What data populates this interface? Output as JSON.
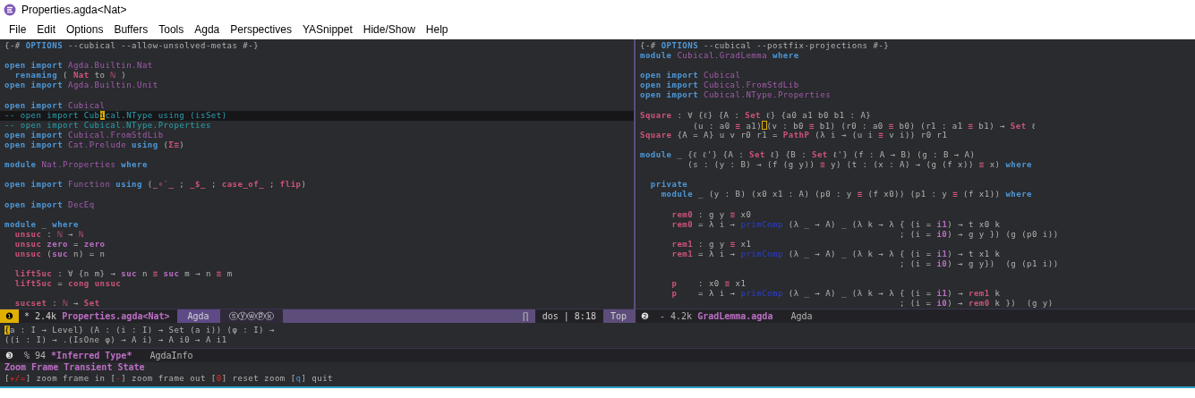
{
  "window": {
    "title": "Properties.agda<Nat>"
  },
  "menu": [
    "File",
    "Edit",
    "Options",
    "Buffers",
    "Tools",
    "Agda",
    "Perspectives",
    "YASnippet",
    "Hide/Show",
    "Help"
  ],
  "panes": [
    {
      "lines": [
        {
          "current": false,
          "segs": [
            {
              "text": "{-# ",
              "kind": "plain"
            },
            {
              "text": "OPTIONS",
              "kind": "keyword"
            },
            {
              "text": " --cubical --allow-unsolved-metas #-}",
              "kind": "plain"
            }
          ]
        },
        {
          "current": false
        },
        {
          "current": false,
          "segs": [
            {
              "text": "open import ",
              "kind": "keyword"
            },
            {
              "text": "Agda.Builtin.Nat",
              "kind": "module"
            }
          ]
        },
        {
          "current": false,
          "segs": [
            {
              "text": "  renaming",
              "kind": "keyword"
            },
            {
              "text": " ( ",
              "kind": "plain"
            },
            {
              "text": "Nat",
              "kind": "function"
            },
            {
              "text": " to ",
              "kind": "plain"
            },
            {
              "text": "ℕ",
              "kind": "function"
            },
            {
              "text": " )",
              "kind": "plain"
            }
          ]
        },
        {
          "current": false,
          "segs": [
            {
              "text": "open import ",
              "kind": "keyword"
            },
            {
              "text": "Agda.Builtin.Unit",
              "kind": "module"
            }
          ]
        },
        {
          "current": false
        },
        {
          "current": false,
          "segs": [
            {
              "text": "open import ",
              "kind": "keyword"
            },
            {
              "text": "Cubical",
              "kind": "module"
            }
          ]
        },
        {
          "current": true,
          "segs": [
            {
              "text": "-- open import Cub",
              "kind": "comment"
            },
            {
              "text": "i",
              "kind": "cursor"
            },
            {
              "text": "cal.NType using (isSet)",
              "kind": "comment"
            }
          ]
        },
        {
          "current": false,
          "segs": [
            {
              "text": "-- open import Cubical.NType.Properties",
              "kind": "comment"
            }
          ]
        },
        {
          "current": false,
          "segs": [
            {
              "text": "open import ",
              "kind": "keyword"
            },
            {
              "text": "Cubical.FromStdLib",
              "kind": "module"
            }
          ]
        },
        {
          "current": false,
          "segs": [
            {
              "text": "open import ",
              "kind": "keyword"
            },
            {
              "text": "Cat.Prelude ",
              "kind": "module"
            },
            {
              "text": "using",
              "kind": "keyword"
            },
            {
              "text": " (",
              "kind": "plain"
            },
            {
              "text": "Σ≡",
              "kind": "function"
            },
            {
              "text": ")",
              "kind": "plain"
            }
          ]
        },
        {
          "current": false
        },
        {
          "current": false,
          "segs": [
            {
              "text": "module ",
              "kind": "keyword"
            },
            {
              "text": "Nat.Properties ",
              "kind": "module"
            },
            {
              "text": "where",
              "kind": "keyword"
            }
          ]
        },
        {
          "current": false
        },
        {
          "current": false,
          "segs": [
            {
              "text": "open import ",
              "kind": "keyword"
            },
            {
              "text": "Function ",
              "kind": "module"
            },
            {
              "text": "using",
              "kind": "keyword"
            },
            {
              "text": " (",
              "kind": "plain"
            },
            {
              "text": "_∘′_",
              "kind": "function"
            },
            {
              "text": " ; ",
              "kind": "plain"
            },
            {
              "text": "_$_",
              "kind": "function"
            },
            {
              "text": " ; ",
              "kind": "plain"
            },
            {
              "text": "case_of_",
              "kind": "function"
            },
            {
              "text": " ; ",
              "kind": "plain"
            },
            {
              "text": "flip",
              "kind": "function"
            },
            {
              "text": ")",
              "kind": "plain"
            }
          ]
        },
        {
          "current": false
        },
        {
          "current": false,
          "segs": [
            {
              "text": "open import ",
              "kind": "keyword"
            },
            {
              "text": "DecEq",
              "kind": "module"
            }
          ]
        },
        {
          "current": false
        },
        {
          "current": false,
          "segs": [
            {
              "text": "module",
              "kind": "keyword"
            },
            {
              "text": " _ ",
              "kind": "plain"
            },
            {
              "text": "where",
              "kind": "keyword"
            }
          ]
        },
        {
          "current": false,
          "segs": [
            {
              "text": "  unsuc",
              "kind": "function"
            },
            {
              "text": " : ",
              "kind": "plain"
            },
            {
              "text": "ℕ",
              "kind": "function"
            },
            {
              "text": " → ",
              "kind": "plain"
            },
            {
              "text": "ℕ",
              "kind": "function"
            }
          ]
        },
        {
          "current": false,
          "segs": [
            {
              "text": "  unsuc ",
              "kind": "function"
            },
            {
              "text": "zero",
              "kind": "constructor"
            },
            {
              "text": " = ",
              "kind": "plain"
            },
            {
              "text": "zero",
              "kind": "constructor"
            }
          ]
        },
        {
          "current": false,
          "segs": [
            {
              "text": "  unsuc",
              "kind": "function"
            },
            {
              "text": " (",
              "kind": "plain"
            },
            {
              "text": "suc",
              "kind": "constructor"
            },
            {
              "text": " n) = n",
              "kind": "plain"
            }
          ]
        },
        {
          "current": false
        },
        {
          "current": false,
          "segs": [
            {
              "text": "  liftSuc",
              "kind": "function"
            },
            {
              "text": " : ∀ {n m} → ",
              "kind": "plain"
            },
            {
              "text": "suc",
              "kind": "constructor"
            },
            {
              "text": " n ",
              "kind": "plain"
            },
            {
              "text": "≡ ",
              "kind": "function"
            },
            {
              "text": "suc",
              "kind": "constructor"
            },
            {
              "text": " m → n ",
              "kind": "plain"
            },
            {
              "text": "≡",
              "kind": "function"
            },
            {
              "text": " m",
              "kind": "plain"
            }
          ]
        },
        {
          "current": false,
          "segs": [
            {
              "text": "  liftSuc",
              "kind": "function"
            },
            {
              "text": " = ",
              "kind": "plain"
            },
            {
              "text": "cong unsuc",
              "kind": "function"
            }
          ]
        },
        {
          "current": false
        },
        {
          "current": false,
          "segs": [
            {
              "text": "  sucset",
              "kind": "function"
            },
            {
              "text": " : ",
              "kind": "plain"
            },
            {
              "text": "ℕ",
              "kind": "function"
            },
            {
              "text": " → ",
              "kind": "plain"
            },
            {
              "text": "Set",
              "kind": "function"
            }
          ]
        }
      ],
      "modeline": {
        "number": "❶",
        "active": true,
        "state": "* 2.4k",
        "buffer": "Properties.agda<Nat>",
        "mode": "Agda",
        "minor_modes": "ⓢⓨⓦⓟⓚ",
        "glyph": "∏",
        "line_info": "dos | 8:18",
        "position": "Top"
      }
    },
    {
      "lines": [
        {
          "current": false,
          "segs": [
            {
              "text": "{-# ",
              "kind": "plain"
            },
            {
              "text": "OPTIONS",
              "kind": "keyword"
            },
            {
              "text": " --cubical --postfix-projections #-}",
              "kind": "plain"
            }
          ]
        },
        {
          "current": false,
          "segs": [
            {
              "text": "module ",
              "kind": "keyword"
            },
            {
              "text": "Cubical.GradLemma ",
              "kind": "module"
            },
            {
              "text": "where",
              "kind": "keyword"
            }
          ]
        },
        {
          "current": false
        },
        {
          "current": false,
          "segs": [
            {
              "text": "open import ",
              "kind": "keyword"
            },
            {
              "text": "Cubical",
              "kind": "module"
            }
          ]
        },
        {
          "current": false,
          "segs": [
            {
              "text": "open import ",
              "kind": "keyword"
            },
            {
              "text": "Cubical.FromStdLib",
              "kind": "module"
            }
          ]
        },
        {
          "current": false,
          "segs": [
            {
              "text": "open import ",
              "kind": "keyword"
            },
            {
              "text": "Cubical.NType.Properties",
              "kind": "module"
            }
          ]
        },
        {
          "current": false
        },
        {
          "current": false,
          "segs": [
            {
              "text": "Square",
              "kind": "function"
            },
            {
              "text": " : ∀ {ℓ} {A : ",
              "kind": "plain"
            },
            {
              "text": "Set",
              "kind": "function"
            },
            {
              "text": " ℓ} {a0 a1 b0 b1 : A}",
              "kind": "plain"
            }
          ]
        },
        {
          "current": false,
          "segs": [
            {
              "text": "          (u : a0 ",
              "kind": "plain"
            },
            {
              "text": "≡",
              "kind": "function"
            },
            {
              "text": " a1)",
              "kind": "plain"
            },
            {
              "text": "(v : b0 ",
              "kind": "plain",
              "box_cursor_before": true
            },
            {
              "text": "≡",
              "kind": "function"
            },
            {
              "text": " b1) (r0 : a0 ",
              "kind": "plain"
            },
            {
              "text": "≡",
              "kind": "function"
            },
            {
              "text": " b0) (r1 : a1 ",
              "kind": "plain"
            },
            {
              "text": "≡",
              "kind": "function"
            },
            {
              "text": " b1) → ",
              "kind": "plain"
            },
            {
              "text": "Set",
              "kind": "function"
            },
            {
              "text": " ℓ",
              "kind": "plain"
            }
          ]
        },
        {
          "current": false,
          "segs": [
            {
              "text": "Square",
              "kind": "function"
            },
            {
              "text": " {A = A} u v r0 r1 = ",
              "kind": "plain"
            },
            {
              "text": "PathP",
              "kind": "function"
            },
            {
              "text": " (λ i → (u i ",
              "kind": "plain"
            },
            {
              "text": "≡",
              "kind": "function"
            },
            {
              "text": " v i)) r0 r1",
              "kind": "plain"
            }
          ]
        },
        {
          "current": false
        },
        {
          "current": false,
          "segs": [
            {
              "text": "module",
              "kind": "keyword"
            },
            {
              "text": " _ {ℓ ℓ'} {A : ",
              "kind": "plain"
            },
            {
              "text": "Set",
              "kind": "function"
            },
            {
              "text": " ℓ} {B : ",
              "kind": "plain"
            },
            {
              "text": "Set",
              "kind": "function"
            },
            {
              "text": " ℓ'} (f : A → B) (g : B → A)",
              "kind": "plain"
            }
          ]
        },
        {
          "current": false,
          "segs": [
            {
              "text": "         (s : (y : B) → (f (g y)) ",
              "kind": "plain"
            },
            {
              "text": "≡",
              "kind": "function"
            },
            {
              "text": " y) (t : (x : A) → (g (f x)) ",
              "kind": "plain"
            },
            {
              "text": "≡",
              "kind": "function"
            },
            {
              "text": " x) ",
              "kind": "plain"
            },
            {
              "text": "where",
              "kind": "keyword"
            }
          ]
        },
        {
          "current": false
        },
        {
          "current": false,
          "segs": [
            {
              "text": "  private",
              "kind": "keyword"
            }
          ]
        },
        {
          "current": false,
          "segs": [
            {
              "text": "    module",
              "kind": "keyword"
            },
            {
              "text": " _ (y : B) (x0 x1 : A) (p0 : y ",
              "kind": "plain"
            },
            {
              "text": "≡",
              "kind": "function"
            },
            {
              "text": " (f x0)) (p1 : y ",
              "kind": "plain"
            },
            {
              "text": "≡",
              "kind": "function"
            },
            {
              "text": " (f x1)) ",
              "kind": "plain"
            },
            {
              "text": "where",
              "kind": "keyword"
            }
          ]
        },
        {
          "current": false
        },
        {
          "current": false,
          "segs": [
            {
              "text": "      rem0",
              "kind": "function"
            },
            {
              "text": " : g y ",
              "kind": "plain"
            },
            {
              "text": "≡",
              "kind": "function"
            },
            {
              "text": " x0",
              "kind": "plain"
            }
          ]
        },
        {
          "current": false,
          "segs": [
            {
              "text": "      rem0",
              "kind": "function"
            },
            {
              "text": " = λ i → ",
              "kind": "plain"
            },
            {
              "text": "primComp",
              "kind": "primitive"
            },
            {
              "text": " (λ _ → A) _ (λ k → λ { (i = ",
              "kind": "plain"
            },
            {
              "text": "i1",
              "kind": "constructor"
            },
            {
              "text": ") → t x0 k",
              "kind": "plain"
            }
          ]
        },
        {
          "current": false,
          "segs": [
            {
              "text": "                                                 ; (i = ",
              "kind": "plain"
            },
            {
              "text": "i0",
              "kind": "constructor"
            },
            {
              "text": ") → g y }) (g (p0 i))",
              "kind": "plain"
            }
          ]
        },
        {
          "current": false,
          "segs": [
            {
              "text": "      rem1",
              "kind": "function"
            },
            {
              "text": " : g y ",
              "kind": "plain"
            },
            {
              "text": "≡",
              "kind": "function"
            },
            {
              "text": " x1",
              "kind": "plain"
            }
          ]
        },
        {
          "current": false,
          "segs": [
            {
              "text": "      rem1",
              "kind": "function"
            },
            {
              "text": " = λ i → ",
              "kind": "plain"
            },
            {
              "text": "primComp",
              "kind": "primitive"
            },
            {
              "text": " (λ _ → A) _ (λ k → λ { (i = ",
              "kind": "plain"
            },
            {
              "text": "i1",
              "kind": "constructor"
            },
            {
              "text": ") → t x1 k",
              "kind": "plain"
            }
          ]
        },
        {
          "current": false,
          "segs": [
            {
              "text": "                                                 ; (i = ",
              "kind": "plain"
            },
            {
              "text": "i0",
              "kind": "constructor"
            },
            {
              "text": ") → g y})  (g (p1 i))",
              "kind": "plain"
            }
          ]
        },
        {
          "current": false
        },
        {
          "current": false,
          "segs": [
            {
              "text": "      p",
              "kind": "function"
            },
            {
              "text": "    : x0 ",
              "kind": "plain"
            },
            {
              "text": "≡",
              "kind": "function"
            },
            {
              "text": " x1",
              "kind": "plain"
            }
          ]
        },
        {
          "current": false,
          "segs": [
            {
              "text": "      p",
              "kind": "function"
            },
            {
              "text": "    = λ i → ",
              "kind": "plain"
            },
            {
              "text": "primComp",
              "kind": "primitive"
            },
            {
              "text": " (λ _ → A) _ (λ k → λ { (i = ",
              "kind": "plain"
            },
            {
              "text": "i1",
              "kind": "constructor"
            },
            {
              "text": ") → ",
              "kind": "plain"
            },
            {
              "text": "rem1",
              "kind": "function"
            },
            {
              "text": " k",
              "kind": "plain"
            }
          ]
        },
        {
          "current": false,
          "segs": [
            {
              "text": "                                                 ; (i = ",
              "kind": "plain"
            },
            {
              "text": "i0",
              "kind": "constructor"
            },
            {
              "text": ") → ",
              "kind": "plain"
            },
            {
              "text": "rem0",
              "kind": "function"
            },
            {
              "text": " k })  (g y)",
              "kind": "plain"
            }
          ]
        }
      ],
      "modeline": {
        "number": "❷",
        "active": false,
        "state": "- 4.2k",
        "buffer": "GradLemma.agda",
        "mode": "Agda"
      }
    }
  ],
  "info": {
    "lines": [
      {
        "segs": [
          {
            "text": "{",
            "kind": "cursor"
          },
          {
            "text": "a : I → Level} (A : (i : I) → Set (a i)) (φ : I) →",
            "kind": "plain"
          }
        ]
      },
      {
        "segs": [
          {
            "text": "((i : I) → .(IsOne φ) → A i) → A i0 → A i1",
            "kind": "plain"
          }
        ]
      }
    ],
    "modeline": {
      "number": "❸",
      "active": false,
      "state": "% 94",
      "buffer": "*Inferred Type*",
      "mode": "AgdaInfo"
    }
  },
  "transient": {
    "title": "Zoom Frame Transient State",
    "hints": {
      "segs": [
        {
          "text": "[",
          "kind": "plain"
        },
        {
          "text": "+/=",
          "kind": "key"
        },
        {
          "text": "] zoom frame in [",
          "kind": "plain"
        },
        {
          "text": "-",
          "kind": "key"
        },
        {
          "text": "] zoom frame out [",
          "kind": "plain"
        },
        {
          "text": "0",
          "kind": "key"
        },
        {
          "text": "] reset zoom [",
          "kind": "plain"
        },
        {
          "text": "q",
          "kind": "exit-key"
        },
        {
          "text": "] quit",
          "kind": "plain"
        }
      ]
    }
  }
}
